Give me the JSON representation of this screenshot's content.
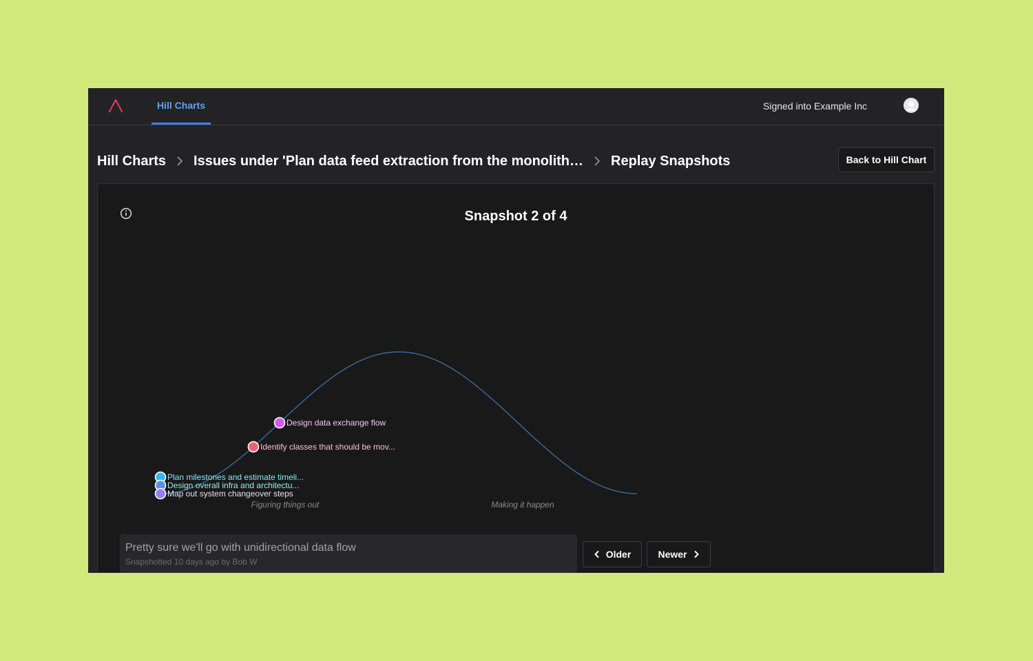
{
  "nav": {
    "tab_label": "Hill Charts",
    "signed_in_text": "Signed into Example Inc"
  },
  "breadcrumb": {
    "root": "Hill Charts",
    "issue": "Issues under 'Plan data feed extraction from the monolith in...",
    "current": "Replay Snapshots"
  },
  "back_button_label": "Back to Hill Chart",
  "snapshot": {
    "title": "Snapshot 2 of 4",
    "note": "Pretty sure we'll go with unidirectional data flow",
    "meta": "Snapshotted 10 days ago by Bob W"
  },
  "pager": {
    "older_label": "Older",
    "newer_label": "Newer"
  },
  "colors": {
    "accent": "#3b82f6",
    "curve": "#3a72a8",
    "logo": "#e0405e"
  },
  "chart_data": {
    "type": "scatter",
    "title": "",
    "phase_labels": [
      "Figuring things out",
      "Making it happen"
    ],
    "x_range": [
      0,
      100
    ],
    "y_range": [
      0,
      1
    ],
    "points": [
      {
        "label": "Design data exchange flow",
        "x": 25,
        "color": "#d458f0",
        "text_color": "#f0c6f7"
      },
      {
        "label": "Identify classes that should be mov...",
        "x": 19.5,
        "color": "#f0607a",
        "text_color": "#fac2cc"
      },
      {
        "label": "Plan milestones and estimate timeli...",
        "x": 0,
        "color": "#38b6f0",
        "text_color": "#8be4f7"
      },
      {
        "label": "Design overall infra and architectu...",
        "x": 0,
        "color": "#5b8ef0",
        "text_color": "#9cf0e0"
      },
      {
        "label": "Map out system changeover steps",
        "x": 0,
        "color": "#9a7cf0",
        "text_color": "#e8e0f7"
      }
    ]
  }
}
